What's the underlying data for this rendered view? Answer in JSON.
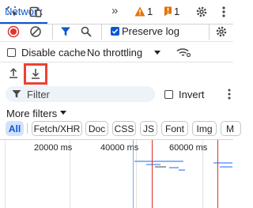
{
  "tabs": {
    "active": "Network",
    "more": "»"
  },
  "badges": {
    "warnings": "1",
    "errors": "1"
  },
  "toolbar": {
    "preserve_log": "Preserve log",
    "disable_cache": "Disable cache",
    "throttling": "No throttling"
  },
  "filter": {
    "placeholder": "Filter",
    "invert": "Invert",
    "more_filters": "More filters"
  },
  "type_chips": [
    "All",
    "Fetch/XHR",
    "Doc",
    "CSS",
    "JS",
    "Font",
    "Img",
    "M"
  ],
  "timeline": {
    "ticks": [
      "20000 ms",
      "40000 ms",
      "60000 ms"
    ]
  },
  "state": {
    "preserve_log": true,
    "disable_cache": false,
    "invert": false,
    "active_chip": "All"
  },
  "colors": {
    "accent": "#0b57d0",
    "record": "#dc362e",
    "highlight": "#ea4335",
    "warning": "#e37400",
    "chip_active_bg": "#d3e3fd"
  },
  "icons": [
    "select-element-icon",
    "device-toolbar-icon",
    "more-tabs-icon",
    "warning-icon",
    "error-icon",
    "settings-icon",
    "more-options-icon",
    "stop-recording-icon",
    "clear-icon",
    "filter-icon",
    "search-icon",
    "settings-icon",
    "network-conditions-icon",
    "import-har-icon",
    "export-har-icon",
    "filter-search-icon",
    "dropdown-arrow-icon"
  ]
}
